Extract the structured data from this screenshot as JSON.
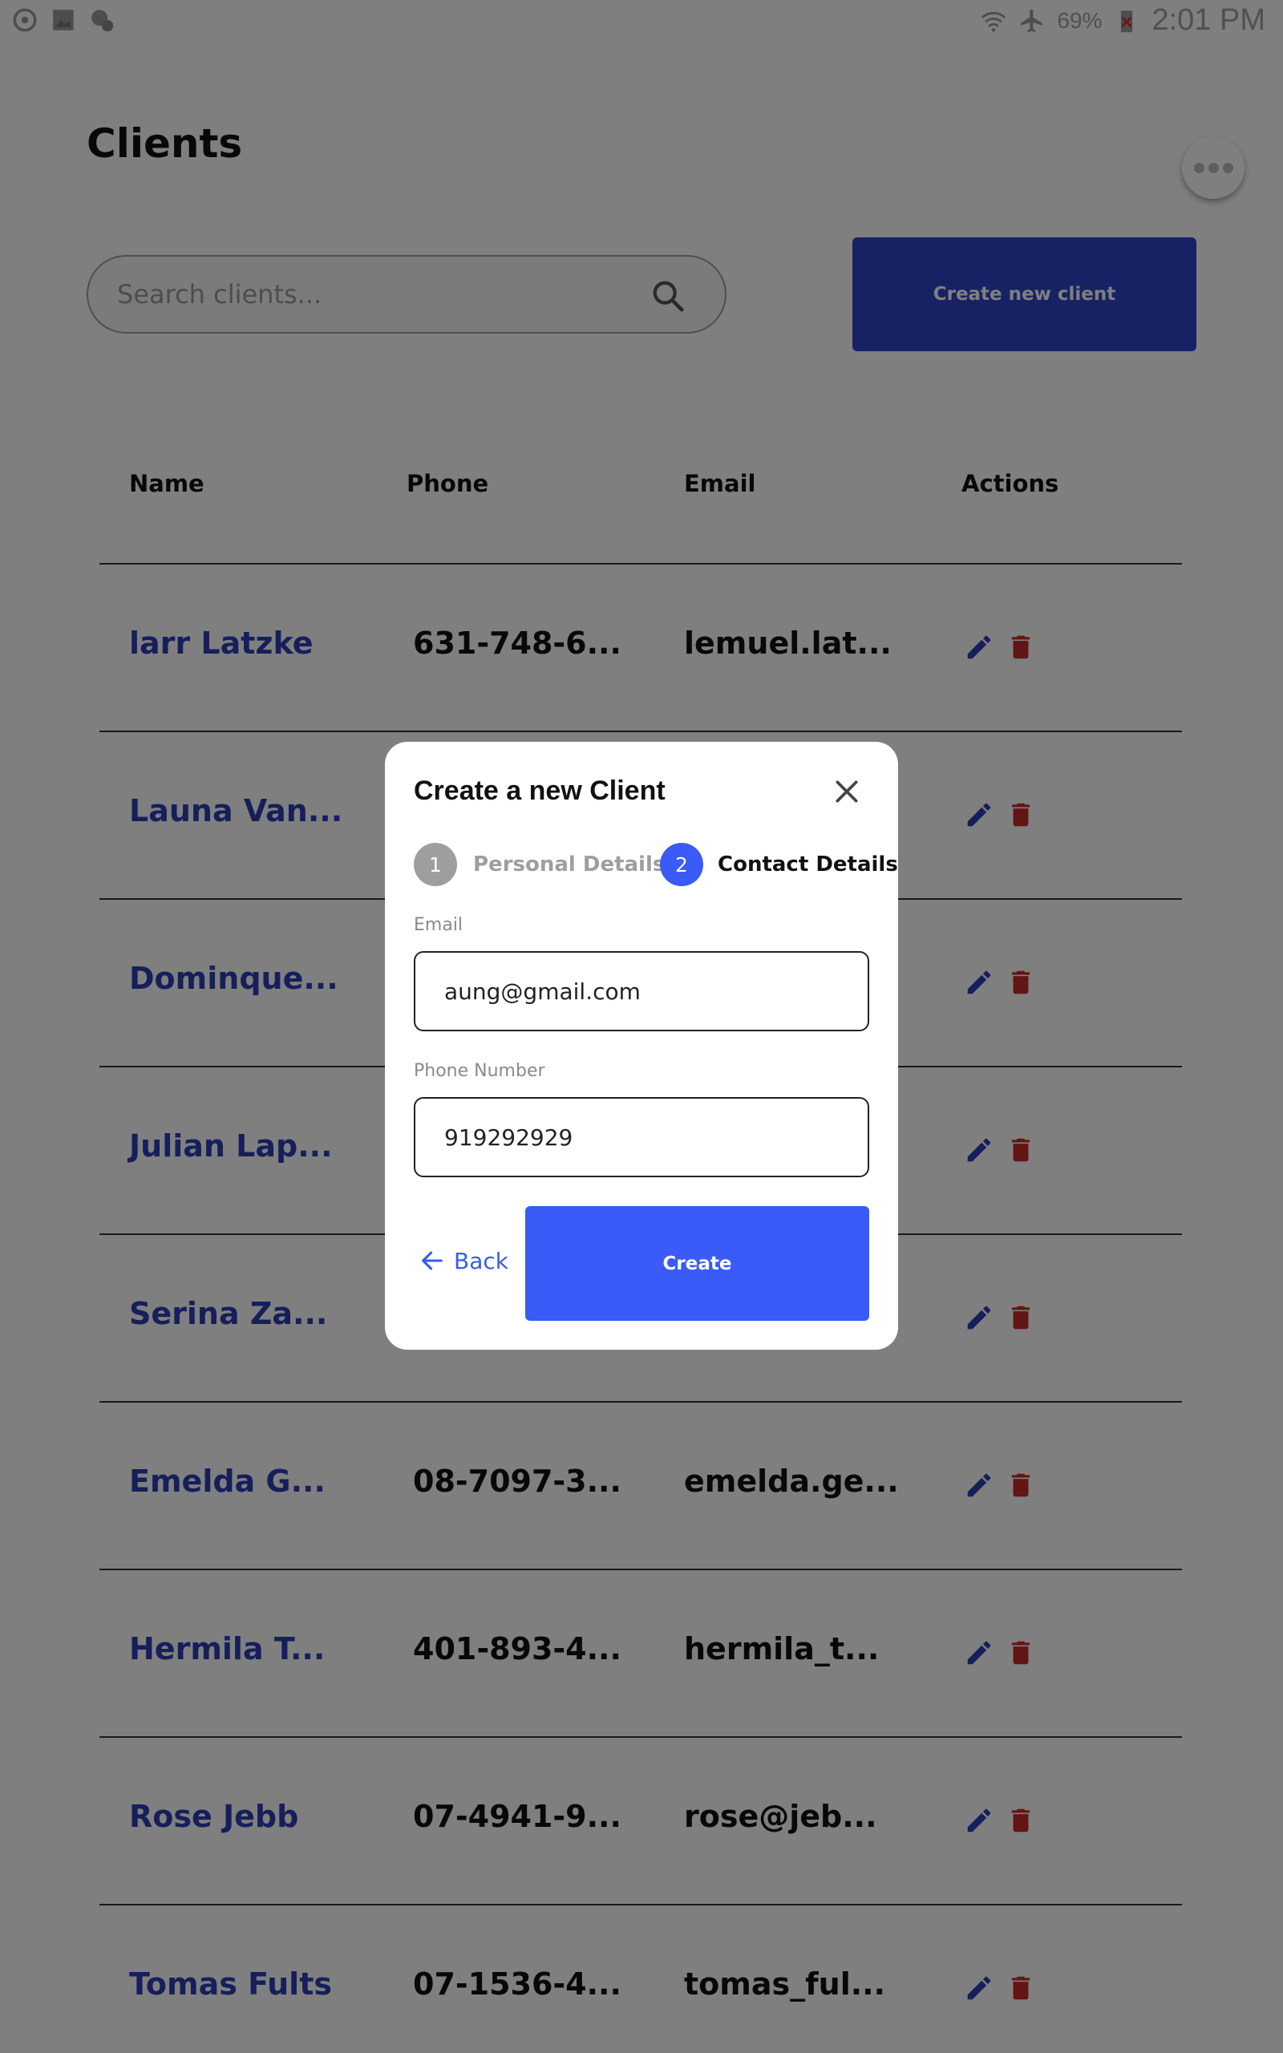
{
  "status_bar": {
    "battery_text": "69%",
    "time": "2:01 PM",
    "icons_left": [
      "sync-icon",
      "image-icon",
      "settings-alert-icon"
    ],
    "icons_right": [
      "wifi-icon",
      "airplane-mode-icon",
      "battery-icon"
    ]
  },
  "page": {
    "title": "Clients",
    "search_placeholder": "Search clients...",
    "create_button": "Create new client",
    "accent_color": "#2f44c8"
  },
  "table": {
    "columns": [
      "Name",
      "Phone",
      "Email",
      "Actions"
    ],
    "rows": [
      {
        "name": "larr Latzke",
        "phone": "631-748-6...",
        "email": "lemuel.lat..."
      },
      {
        "name": "Launa Van...",
        "phone": "",
        "email": ""
      },
      {
        "name": "Dominque...",
        "phone": "",
        "email": ""
      },
      {
        "name": "Julian Lap...",
        "phone": "",
        "email": ""
      },
      {
        "name": "Serina Za...",
        "phone": "",
        "email": ""
      },
      {
        "name": "Emelda G...",
        "phone": "08-7097-3...",
        "email": "emelda.ge..."
      },
      {
        "name": "Hermila T...",
        "phone": "401-893-4...",
        "email": "hermila_t..."
      },
      {
        "name": "Rose Jebb",
        "phone": "07-4941-9...",
        "email": "rose@jeb..."
      },
      {
        "name": "Tomas Fults",
        "phone": "07-1536-4...",
        "email": "tomas_ful..."
      }
    ],
    "edit_color": "#2c3fb6",
    "delete_color": "#c62828"
  },
  "modal": {
    "title": "Create a new Client",
    "steps": [
      {
        "number": "1",
        "label": "Personal Details",
        "active": false
      },
      {
        "number": "2",
        "label": "Contact Details",
        "active": true
      }
    ],
    "email_label": "Email",
    "email_value": "aung@gmail.com",
    "phone_label": "Phone Number",
    "phone_value": "919292929",
    "back_label": "Back",
    "create_label": "Create",
    "primary_color": "#3a5bf7"
  }
}
